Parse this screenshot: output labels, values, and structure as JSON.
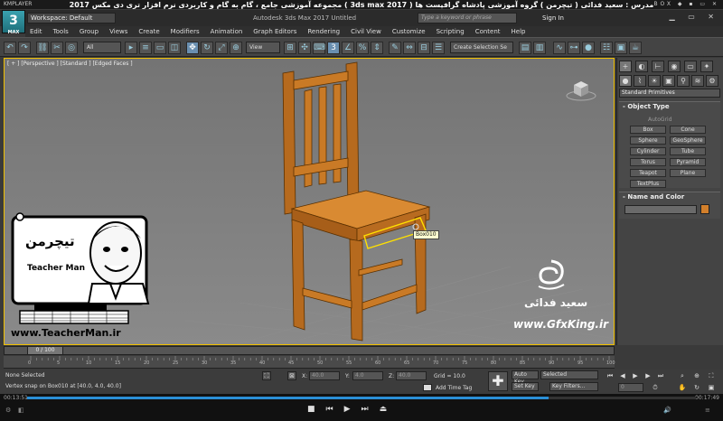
{
  "player": {
    "name": "KMPLAYER",
    "course_title": "مجموعه آموزشی جامع ، گام به گام و کاربردی نرم افزار تری دی مکس 2017  ( 3ds max 2017 )  مدرس : سعید فدائی ( تیچرمن ) گروه آموزشی پادشاه گرافیست ها",
    "window_controls": "BOX ◆ ▪ ▭ ✕",
    "time_elapsed": "00:13:51",
    "time_total": "00:17:49",
    "progress": 0.78
  },
  "max": {
    "logo_text": "3",
    "logo_sub": "MAX",
    "workspace": "Workspace: Default",
    "app_title": "Autodesk 3ds Max 2017    Untitled",
    "search_placeholder": "Type a keyword or phrase",
    "sign_in": "Sign In",
    "window_controls": "▁ ▭ ✕"
  },
  "menu": [
    "Edit",
    "Tools",
    "Group",
    "Views",
    "Create",
    "Modifiers",
    "Animation",
    "Graph Editors",
    "Rendering",
    "Civil View",
    "Customize",
    "Scripting",
    "Content",
    "Help"
  ],
  "toolbar": {
    "filter": "All",
    "ref_coord": "View",
    "selection_set": "Create Selection Se"
  },
  "viewport": {
    "label": "[ + ] [Perspective ] [Standard ] [Edged Faces ]",
    "tooltip": "Box010"
  },
  "command_panel": {
    "primitive_type": "Standard Primitives",
    "object_type_title": "Object Type",
    "autogrid": "AutoGrid",
    "objects": [
      "Box",
      "Cone",
      "Sphere",
      "GeoSphere",
      "Cylinder",
      "Tube",
      "Torus",
      "Pyramid",
      "Teapot",
      "Plane",
      "TextPlus"
    ],
    "name_color_title": "Name and Color",
    "color": "#d27f2b"
  },
  "timeline": {
    "frame_display": "0 / 100",
    "ticks": [
      "0",
      "5",
      "10",
      "15",
      "20",
      "25",
      "30",
      "35",
      "40",
      "45",
      "50",
      "55",
      "60",
      "65",
      "70",
      "75",
      "80",
      "85",
      "90",
      "95",
      "100"
    ],
    "current_frame": 0,
    "frame_count": 100
  },
  "status": {
    "selection": "None Selected",
    "prompt": "Vertex snap on Box010 at [40.0, 4.0, 40.0]",
    "x_label": "X:",
    "x_value": "40.0",
    "y_label": "Y:",
    "y_value": "4.0",
    "z_label": "Z:",
    "z_value": "40.0",
    "grid": "Grid = 10.0",
    "add_time_tag": "Add Time Tag",
    "auto_key": "Auto Key",
    "set_key": "Set Key",
    "selected": "Selected",
    "key_filters": "Key Filters..."
  },
  "overlays": {
    "teacher_name_fa": "تیچرمن",
    "teacher_name_en": "Teacher Man",
    "teacher_url": "www.TeacherMan.ir",
    "gfx_name": "سعید فدائی",
    "gfx_url": "www.GfxKing.ir"
  }
}
